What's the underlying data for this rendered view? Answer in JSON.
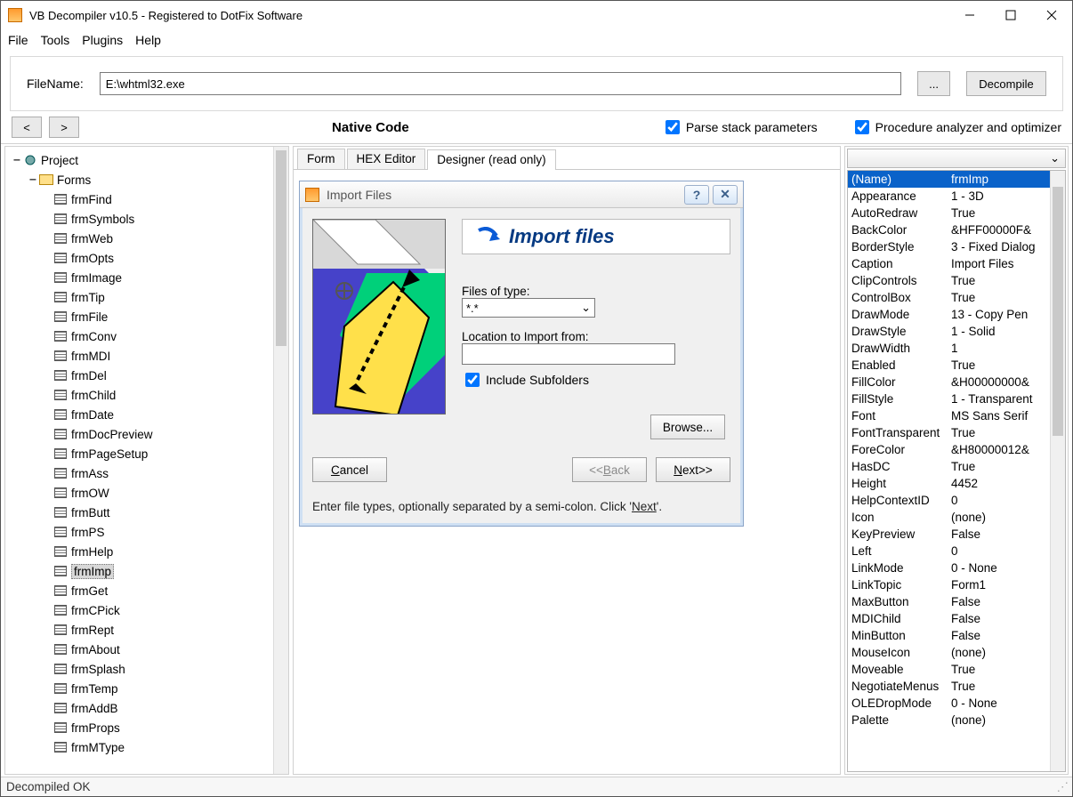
{
  "window": {
    "title": "VB Decompiler v10.5 - Registered to DotFix Software"
  },
  "menu": {
    "file": "File",
    "tools": "Tools",
    "plugins": "Plugins",
    "help": "Help"
  },
  "top": {
    "filename_label": "FileName:",
    "filename_value": "E:\\whtml32.exe",
    "browse_btn": "...",
    "decompile_btn": "Decompile"
  },
  "subbar": {
    "back": "<",
    "fwd": ">",
    "mode": "Native Code",
    "parse": "Parse stack parameters",
    "analyzer": "Procedure analyzer and optimizer"
  },
  "tree": {
    "root": "Project",
    "forms_label": "Forms",
    "items": [
      "frmFind",
      "frmSymbols",
      "frmWeb",
      "frmOpts",
      "frmImage",
      "frmTip",
      "frmFile",
      "frmConv",
      "frmMDI",
      "frmDel",
      "frmChild",
      "frmDate",
      "frmDocPreview",
      "frmPageSetup",
      "frmAss",
      "frmOW",
      "frmButt",
      "frmPS",
      "frmHelp",
      "frmImp",
      "frmGet",
      "frmCPick",
      "frmRept",
      "frmAbout",
      "frmSplash",
      "frmTemp",
      "frmAddB",
      "frmProps",
      "frmMType"
    ],
    "selected_index": 19
  },
  "tabs": {
    "form": "Form",
    "hex": "HEX Editor",
    "designer": "Designer (read only)"
  },
  "inner": {
    "title": "Import Files",
    "banner": "Import files",
    "files_of_type_label": "Files of type:",
    "files_of_type_value": "*.*",
    "location_label": "Location to Import from:",
    "include_subfolders": "Include Subfolders",
    "browse": "Browse...",
    "cancel": "Cancel",
    "back": "Back",
    "next": "Next",
    "hint_pre": "Enter file types, optionally separated by a semi-colon. Click '",
    "hint_link": "Next",
    "hint_post": "'."
  },
  "props": [
    {
      "n": "(Name)",
      "v": "frmImp",
      "sel": true
    },
    {
      "n": "Appearance",
      "v": "1 - 3D"
    },
    {
      "n": "AutoRedraw",
      "v": "True"
    },
    {
      "n": "BackColor",
      "v": "&HFF00000F&"
    },
    {
      "n": "BorderStyle",
      "v": "3 - Fixed Dialog"
    },
    {
      "n": "Caption",
      "v": "Import Files"
    },
    {
      "n": "ClipControls",
      "v": "True"
    },
    {
      "n": "ControlBox",
      "v": "True"
    },
    {
      "n": "DrawMode",
      "v": "13 - Copy Pen"
    },
    {
      "n": "DrawStyle",
      "v": "1 - Solid"
    },
    {
      "n": "DrawWidth",
      "v": "1"
    },
    {
      "n": "Enabled",
      "v": "True"
    },
    {
      "n": "FillColor",
      "v": "&H00000000&"
    },
    {
      "n": "FillStyle",
      "v": "1 - Transparent"
    },
    {
      "n": "Font",
      "v": "MS Sans Serif"
    },
    {
      "n": "FontTransparent",
      "v": "True"
    },
    {
      "n": "ForeColor",
      "v": "&H80000012&"
    },
    {
      "n": "HasDC",
      "v": "True"
    },
    {
      "n": "Height",
      "v": "4452"
    },
    {
      "n": "HelpContextID",
      "v": "0"
    },
    {
      "n": "Icon",
      "v": "(none)"
    },
    {
      "n": "KeyPreview",
      "v": "False"
    },
    {
      "n": "Left",
      "v": "0"
    },
    {
      "n": "LinkMode",
      "v": "0 - None"
    },
    {
      "n": "LinkTopic",
      "v": "Form1"
    },
    {
      "n": "MaxButton",
      "v": "False"
    },
    {
      "n": "MDIChild",
      "v": "False"
    },
    {
      "n": "MinButton",
      "v": "False"
    },
    {
      "n": "MouseIcon",
      "v": "(none)"
    },
    {
      "n": "Moveable",
      "v": "True"
    },
    {
      "n": "NegotiateMenus",
      "v": "True"
    },
    {
      "n": "OLEDropMode",
      "v": "0 - None"
    },
    {
      "n": "Palette",
      "v": "(none)"
    }
  ],
  "status": {
    "text": "Decompiled OK"
  }
}
